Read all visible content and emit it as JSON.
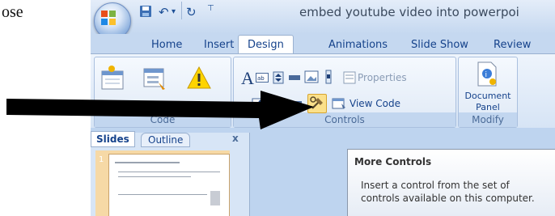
{
  "document": {
    "fragment": "ose"
  },
  "titlebar": {
    "title": "embed youtube video into powerpoi"
  },
  "tabs": [
    {
      "label": "Home"
    },
    {
      "label": "Insert"
    },
    {
      "label": "Design"
    },
    {
      "label": "Animations"
    },
    {
      "label": "Slide Show"
    },
    {
      "label": "Review"
    }
  ],
  "groups": {
    "code": {
      "label": "Code"
    },
    "controls": {
      "label": "Controls",
      "properties": "Properties",
      "view_code": "View Code"
    },
    "modify": {
      "label": "Modify",
      "doc_panel_1": "Document",
      "doc_panel_2": "Panel"
    }
  },
  "panes": {
    "slides": "Slides",
    "outline": "Outline",
    "close": "x",
    "slide_number": "1"
  },
  "tooltip": {
    "title": "More Controls",
    "body": "Insert a control from the set of controls available on this computer."
  },
  "colors": {
    "accent": "#15428b",
    "ribbon": "#d6e4f5",
    "arrow": "#000000"
  }
}
